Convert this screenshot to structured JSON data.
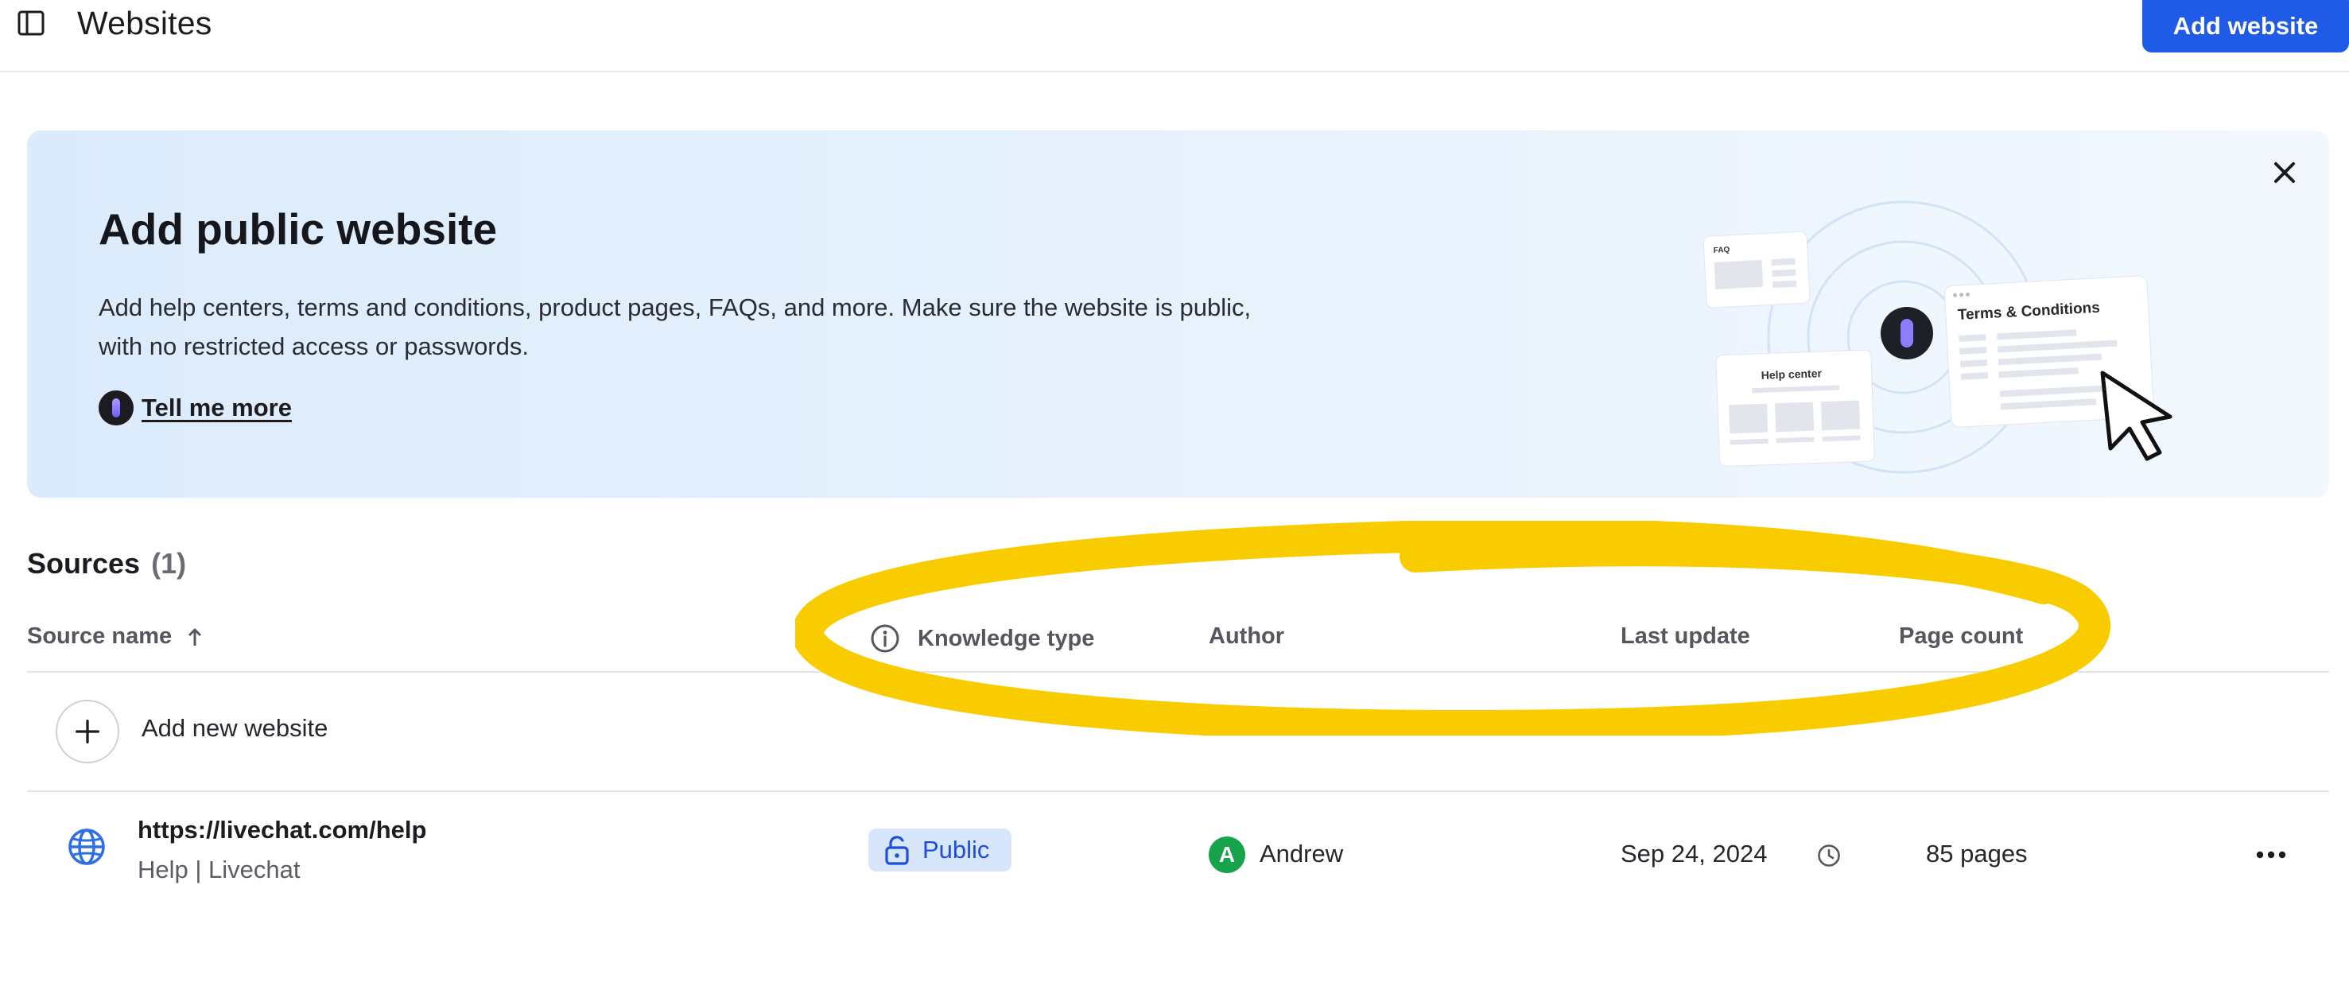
{
  "header": {
    "title": "Websites",
    "add_button_label": "Add website"
  },
  "banner": {
    "title": "Add public website",
    "description": "Add help centers, terms and conditions, product pages, FAQs, and more. Make sure the website is public, with no restricted access or passwords.",
    "link_label": "Tell me more",
    "illustration": {
      "faq_card_label": "FAQ",
      "help_center_card_label": "Help center",
      "terms_card_label": "Terms & Conditions"
    }
  },
  "sources": {
    "heading": "Sources",
    "count_label": "(1)"
  },
  "table": {
    "columns": {
      "source_name": "Source name",
      "knowledge_type": "Knowledge type",
      "author": "Author",
      "last_update": "Last update",
      "page_count": "Page count"
    },
    "add_row_label": "Add new website",
    "rows": [
      {
        "url": "https://livechat.com/help",
        "subtitle": "Help | Livechat",
        "knowledge_type": "Public",
        "author_initial": "A",
        "author_name": "Andrew",
        "last_update": "Sep 24, 2024",
        "page_count": "85 pages"
      }
    ]
  },
  "icons": {
    "sidebar_toggle": "sidebar-toggle-icon",
    "close": "close-icon",
    "sort": "arrow-up-icon",
    "info": "info-icon",
    "plus": "plus-icon",
    "globe": "globe-icon",
    "lock": "lock-open-icon",
    "clock": "clock-icon",
    "more": "more-horizontal-icon"
  },
  "colors": {
    "primary": "#1f5be7",
    "banner_bg": "#dcebfc",
    "badge_bg": "#d7e6fb",
    "badge_text": "#1d4fd8",
    "avatar_bg": "#16a34a",
    "highlight": "#f9cc00"
  }
}
